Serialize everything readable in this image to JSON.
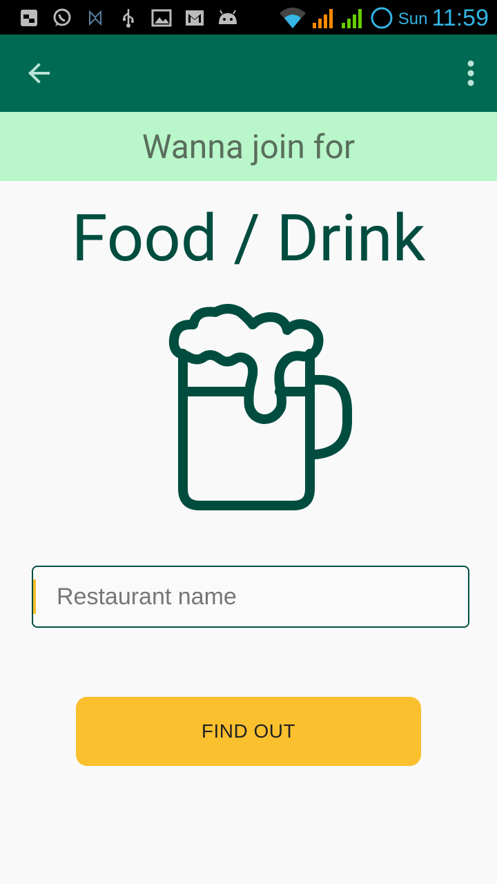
{
  "status_bar": {
    "icons": [
      "gallery-icon",
      "whatsapp-icon",
      "app-icon",
      "usb-icon",
      "image-icon",
      "gmail-icon",
      "android-icon"
    ],
    "day": "Sun",
    "time": "11:59"
  },
  "app_bar": {
    "back": "arrow-back-icon",
    "menu": "more-vert-icon",
    "color": "#006a52"
  },
  "subtitle": "Wanna join for",
  "title": "Food / Drink",
  "illustration": "beer-mug-icon",
  "search": {
    "placeholder": "Restaurant name",
    "value": ""
  },
  "button": {
    "label": "FIND OUT",
    "color": "#fbc02d"
  },
  "colors": {
    "band": "#b9f6ca",
    "title": "#004d40"
  }
}
